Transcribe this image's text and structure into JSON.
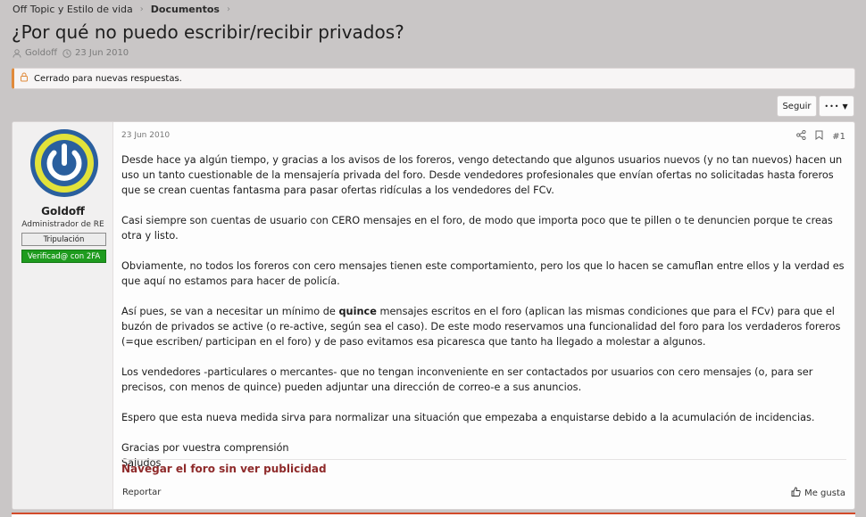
{
  "breadcrumb": {
    "parent": "Off Topic y Estilo de vida",
    "current": "Documentos"
  },
  "thread": {
    "title": "¿Por qué no puedo escribir/recibir privados?",
    "author": "Goldoff",
    "date": "23 Jun 2010",
    "closed_notice": "Cerrado para nuevas respuestas."
  },
  "toolbar": {
    "follow_label": "Seguir",
    "more_label": "•••"
  },
  "post": {
    "date": "23 Jun 2010",
    "number": "#1",
    "user": {
      "name": "Goldoff",
      "title": "Administrador de RE",
      "badge_crew": "Tripulación",
      "badge_2fa": "Verificad@ con 2FA",
      "avatar_icon": "power-icon"
    },
    "body": {
      "p1": "Desde hace ya algún tiempo, y gracias a los avisos de los foreros, vengo detectando que algunos usuarios nuevos (y no tan nuevos) hacen un uso un tanto cuestionable de la mensajería privada del foro. Desde vendedores profesionales que envían ofertas no solicitadas hasta foreros que se crean cuentas fantasma para pasar ofertas ridículas a los vendedores del FCv.",
      "p2": "Casi siempre son cuentas de usuario con CERO mensajes en el foro, de modo que importa poco que te pillen o te denuncien porque te creas otra y listo.",
      "p3": "Obviamente, no todos los foreros con cero mensajes tienen este comportamiento, pero los que lo hacen se camuflan entre ellos y la verdad es que aquí no estamos para hacer de policía.",
      "p4_before": "Así pues, se van a necesitar un mínimo de ",
      "p4_bold": "quince",
      "p4_after": " mensajes escritos en el foro (aplican las mismas condiciones que para el FCv) para que el buzón de privados se active (o re-active, según sea el caso). De este modo reservamos una funcionalidad del foro para los verdaderos foreros (=que escriben/ participan en el foro) y de paso evitamos esa picaresca que tanto ha llegado a molestar a algunos.",
      "p5": "Los vendedores -particulares o mercantes- que no tengan inconveniente en ser contactados por usuarios con cero mensajes (o, para ser precisos, con menos de quince) pueden adjuntar una dirección de correo-e a sus anuncios.",
      "p6": "Espero que esta nueva medida sirva para normalizar una situación que empezaba a enquistarse debido a la acumulación de incidencias.",
      "closing1": "Gracias por vuestra comprensión",
      "closing2": "Saludos"
    },
    "signature_link": "Navegar el foro sin ver publicidad",
    "report_label": "Reportar",
    "like_label": "Me gusta"
  },
  "colors": {
    "background": "#c9c6c6",
    "accent_warning": "#e08a3a",
    "badge_green": "#1e9b1e",
    "signature_red": "#8e2a2a",
    "avatar_blue": "#2a5f9e",
    "avatar_yellow": "#e2e23a"
  }
}
